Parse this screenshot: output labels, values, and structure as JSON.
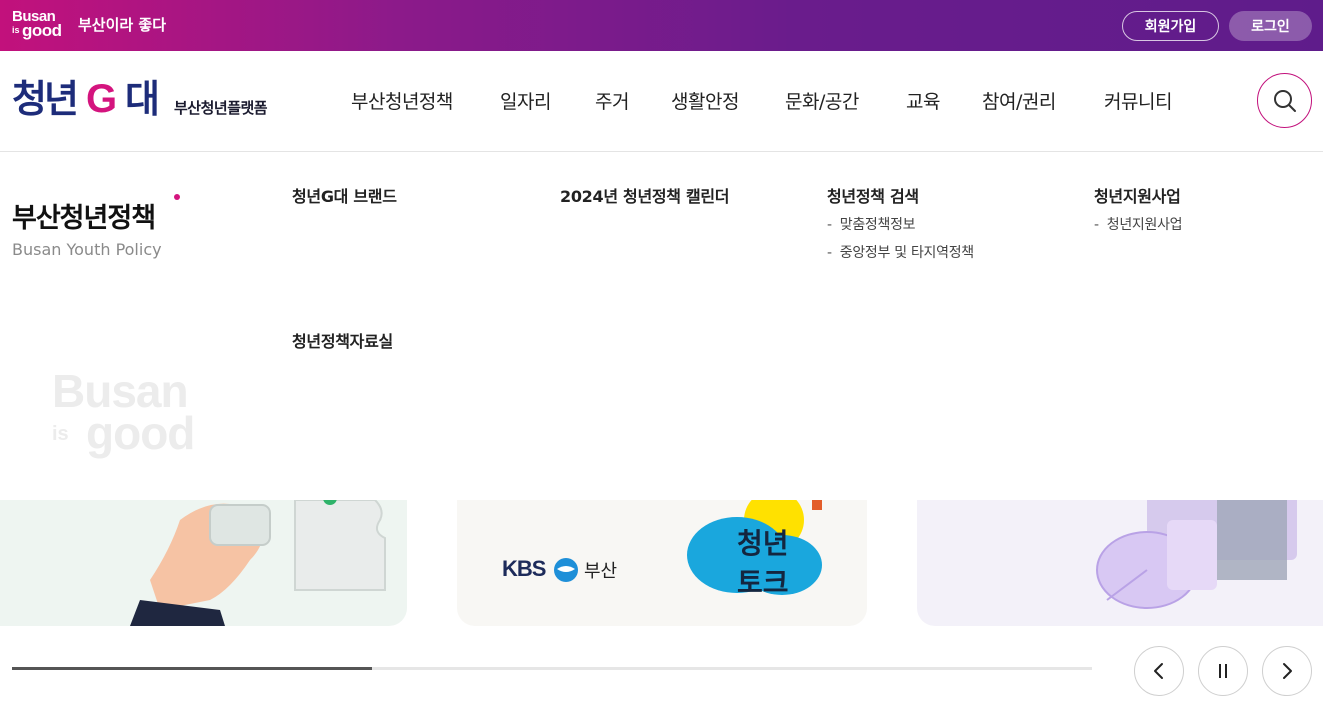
{
  "topbar": {
    "brand_line1": "Busan",
    "brand_line2a": "is",
    "brand_line2b": "good",
    "slogan": "부산이라 좋다",
    "join_label": "회원가입",
    "login_label": "로그인"
  },
  "header": {
    "logo_main": "청년",
    "logo_g": "G",
    "logo_dae": "대",
    "logo_sub": "부산청년플랫폼",
    "nav": [
      "부산청년정책",
      "일자리",
      "주거",
      "생활안정",
      "문화/공간",
      "교육",
      "참여/권리",
      "커뮤니티"
    ],
    "search_icon": "search-icon"
  },
  "mega": {
    "title": "부산청년정책",
    "subtitle": "Busan Youth Policy",
    "watermark_line1": "Busan",
    "watermark_line2a": "is",
    "watermark_line2b": "good",
    "columns": [
      {
        "heading": "청년G대 브랜드",
        "items": []
      },
      {
        "heading": "2024년 청년정책 캘린더",
        "items": []
      },
      {
        "heading": "청년정책 검색",
        "items": [
          "맞춤정책정보",
          "중앙정부 및 타지역정책"
        ]
      },
      {
        "heading": "청년지원사업",
        "items": [
          "청년지원사업"
        ]
      },
      {
        "heading": "청년정책자료실",
        "items": []
      }
    ]
  },
  "cards": {
    "card2_brand": "KBS",
    "card2_region": "부산",
    "card2_badge_line1": "청년",
    "card2_badge_line2": "토크"
  },
  "slider": {
    "progress": 0.333,
    "prev_icon": "chevron-left-icon",
    "pause_icon": "pause-icon",
    "next_icon": "chevron-right-icon"
  },
  "colors": {
    "brand_pink": "#d4147e",
    "brand_purple": "#5f1c8b",
    "logo_navy": "#1d2c7a"
  }
}
